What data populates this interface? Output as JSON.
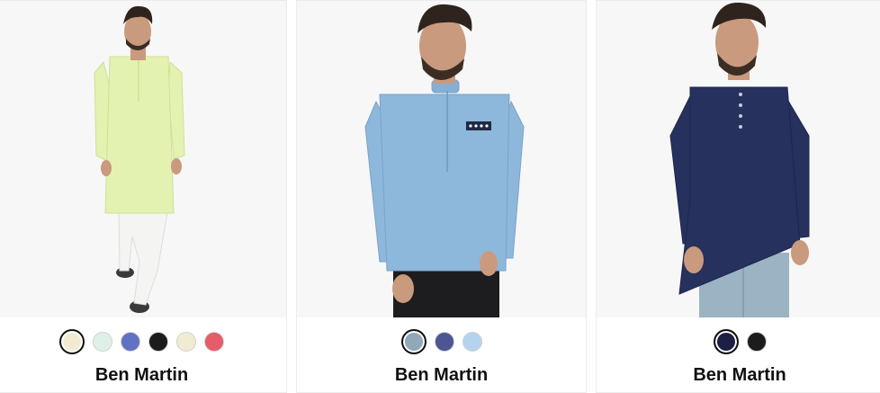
{
  "products": [
    {
      "brand": "Ben Martin",
      "garment_color": "#e3f2b0",
      "swatches": [
        {
          "color": "#f1ebd3",
          "selected": true
        },
        {
          "color": "#dff0e8",
          "selected": false
        },
        {
          "color": "#6272c2",
          "selected": false
        },
        {
          "color": "#1c1c1c",
          "selected": false
        },
        {
          "color": "#f1ebd3",
          "selected": false
        },
        {
          "color": "#e55d69",
          "selected": false
        }
      ]
    },
    {
      "brand": "Ben Martin",
      "garment_color": "#8eb7dc",
      "swatches": [
        {
          "color": "#90a8b8",
          "selected": true
        },
        {
          "color": "#4d5592",
          "selected": false
        },
        {
          "color": "#b6d3ee",
          "selected": false
        }
      ]
    },
    {
      "brand": "Ben Martin",
      "garment_color": "#26315e",
      "swatches": [
        {
          "color": "#1d1f44",
          "selected": true
        },
        {
          "color": "#1c1c1c",
          "selected": false
        }
      ]
    }
  ]
}
